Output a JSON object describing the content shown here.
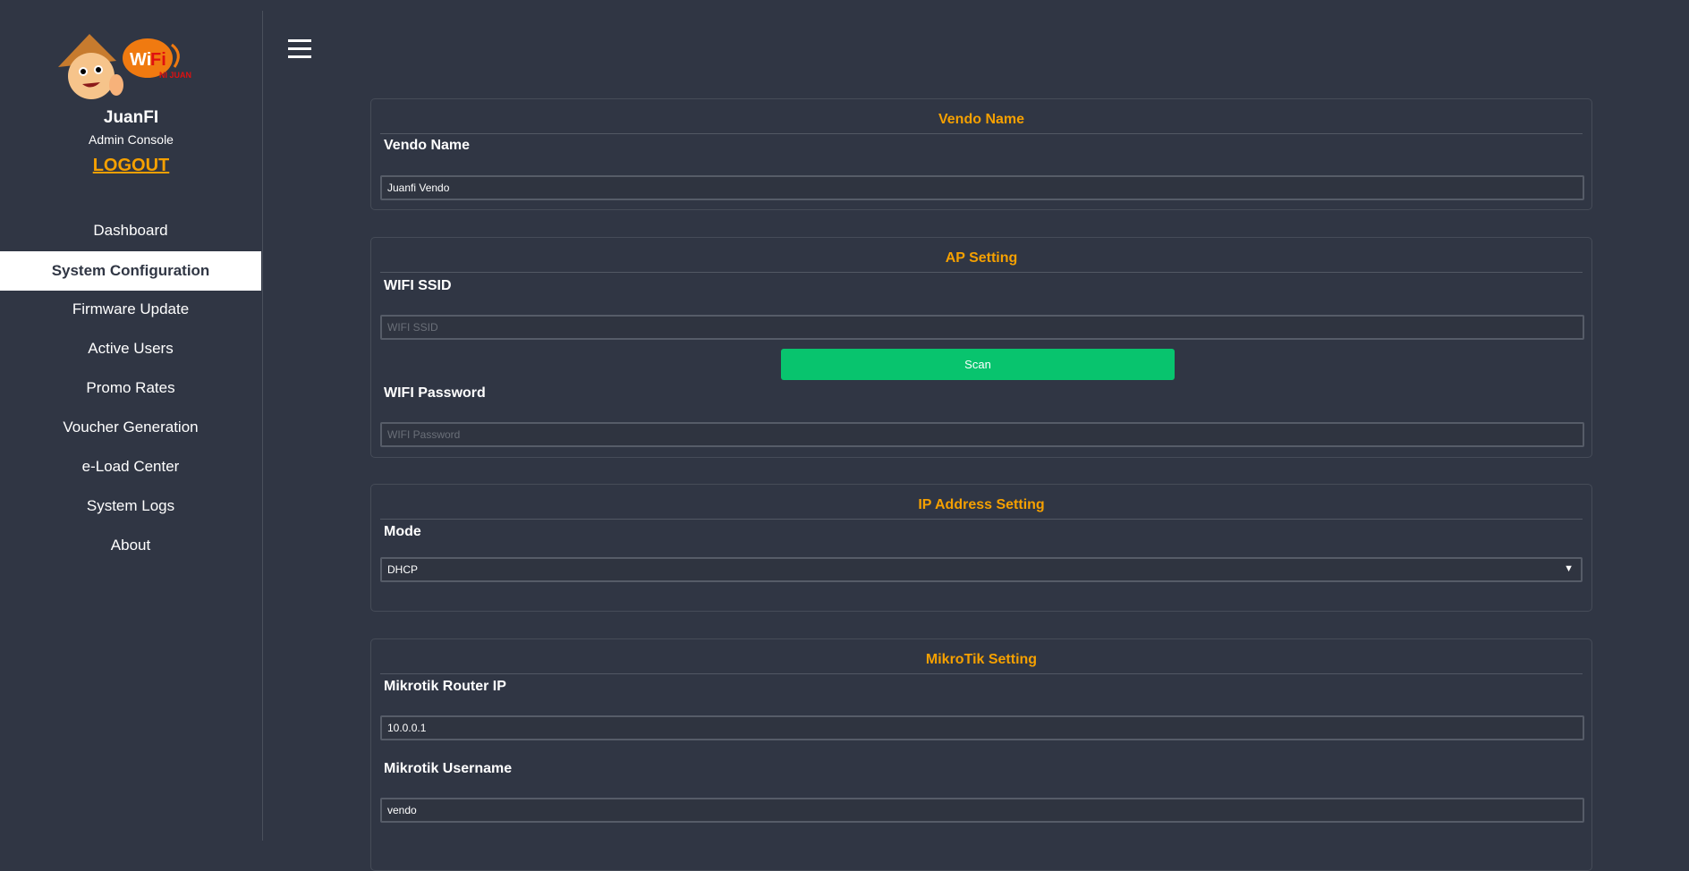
{
  "sidebar": {
    "logo_text": "WiFi NI JUAN",
    "app_name": "JuanFI",
    "subtitle": "Admin Console",
    "logout": "LOGOUT",
    "active_item": "System Configuration",
    "items": [
      {
        "label": "Dashboard"
      },
      {
        "label": "System Configuration"
      },
      {
        "label": "Firmware Update"
      },
      {
        "label": "Active Users"
      },
      {
        "label": "Promo Rates"
      },
      {
        "label": "Voucher Generation"
      },
      {
        "label": "e-Load Center"
      },
      {
        "label": "System Logs"
      },
      {
        "label": "About"
      }
    ]
  },
  "colors": {
    "accent": "#f5a000",
    "button": "#08c46e",
    "background": "#303644"
  },
  "vendo": {
    "title": "Vendo Name",
    "label": "Vendo Name",
    "value": "Juanfi Vendo"
  },
  "ap": {
    "title": "AP Setting",
    "ssid_label": "WIFI SSID",
    "ssid_placeholder": "WIFI SSID",
    "scan": "Scan",
    "pass_label": "WIFI Password",
    "pass_placeholder": "WIFI Password"
  },
  "ip": {
    "title": "IP Address Setting",
    "mode_label": "Mode",
    "mode_value": "DHCP"
  },
  "mikrotik": {
    "title": "MikroTik Setting",
    "ip_label": "Mikrotik Router IP",
    "ip_value": "10.0.0.1",
    "user_label": "Mikrotik Username",
    "user_value": "vendo"
  }
}
